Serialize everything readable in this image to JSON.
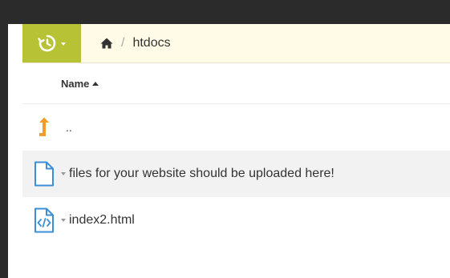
{
  "toolbar": {
    "history_icon": "history-icon",
    "home_icon": "home-icon",
    "breadcrumb_sep": "/",
    "breadcrumb_current": "htdocs",
    "accent": "#b7c235"
  },
  "table": {
    "column_name": "Name",
    "rows": [
      {
        "type": "parent",
        "label": "..",
        "icon": "up-arrow-icon"
      },
      {
        "type": "file",
        "label": "files for your website should be uploaded here!",
        "icon": "file-icon"
      },
      {
        "type": "file",
        "label": "index2.html",
        "icon": "code-file-icon"
      }
    ]
  }
}
